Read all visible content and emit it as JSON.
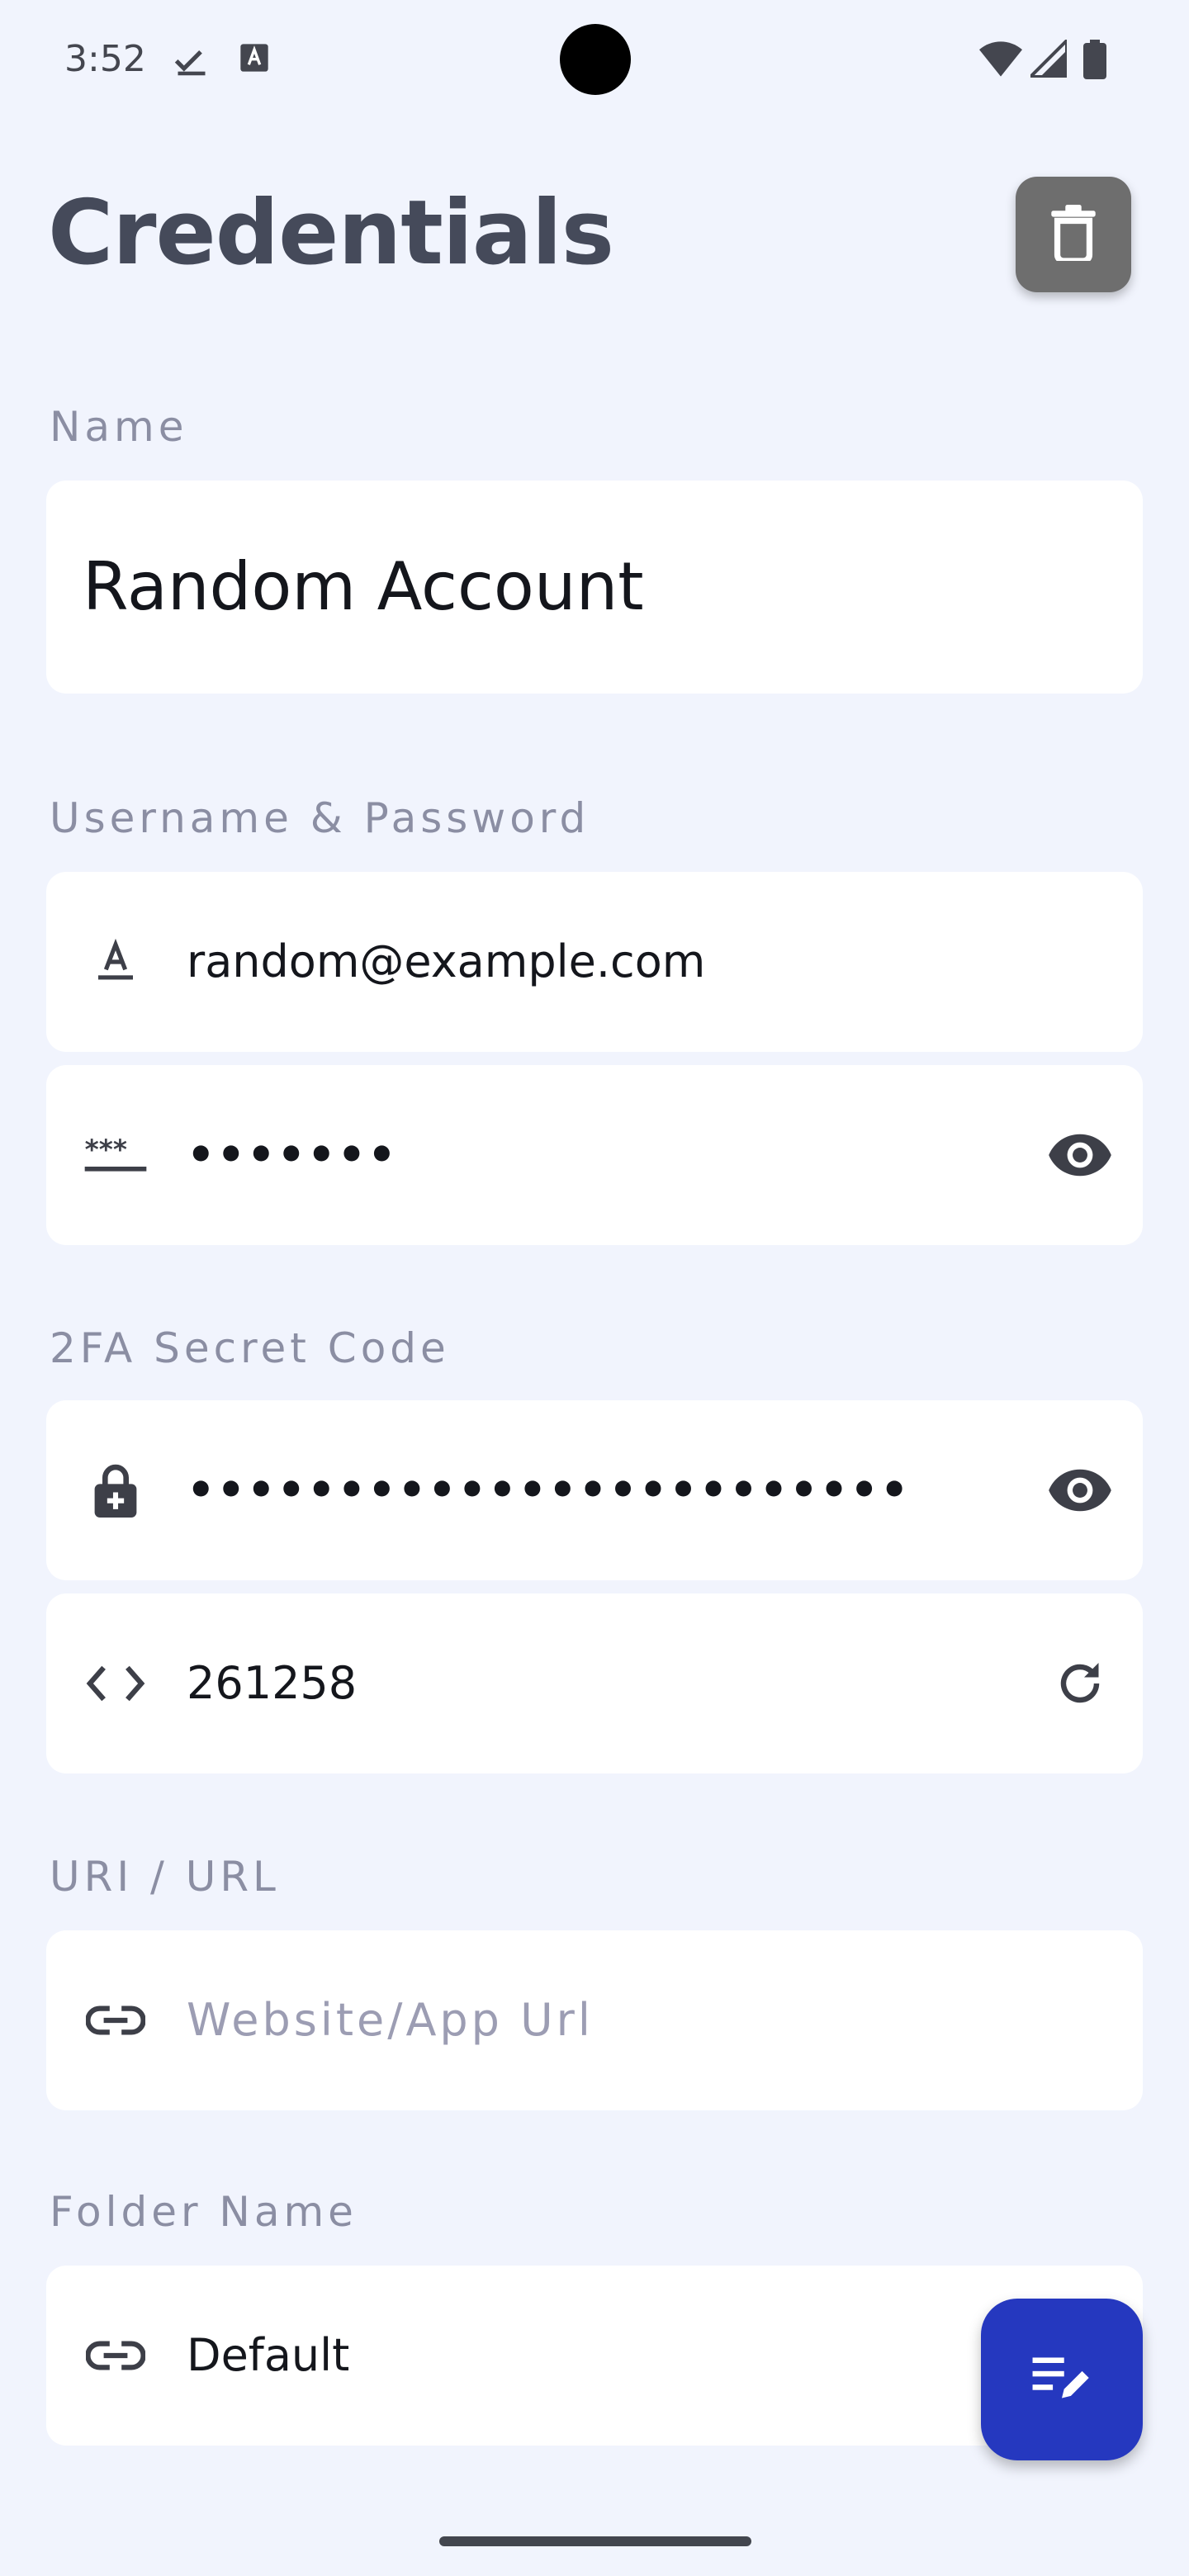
{
  "status_bar": {
    "time": "3:52",
    "icons": [
      "download-done-icon",
      "keyboard-icon",
      "wifi-icon",
      "signal-icon",
      "battery-icon"
    ]
  },
  "header": {
    "title": "Credentials",
    "delete_icon": "trash-icon"
  },
  "sections": {
    "name": {
      "label": "Name",
      "value": "Random Account"
    },
    "credentials": {
      "label": "Username & Password",
      "username": "random@example.com",
      "password_masked": "•••••••"
    },
    "two_fa": {
      "label": "2FA Secret Code",
      "secret_masked": "••••••••••••••••••••••••",
      "code": "261258"
    },
    "url": {
      "label": "URI / URL",
      "placeholder": "Website/App Url"
    },
    "folder": {
      "label": "Folder Name",
      "value": "Default"
    }
  },
  "colors": {
    "background": "#f1f4fd",
    "card": "#ffffff",
    "fab": "#2538bf",
    "delete_button": "#6e6e6e",
    "section_label": "#8b8ea3"
  },
  "fab": {
    "icon": "edit-notes-icon"
  }
}
